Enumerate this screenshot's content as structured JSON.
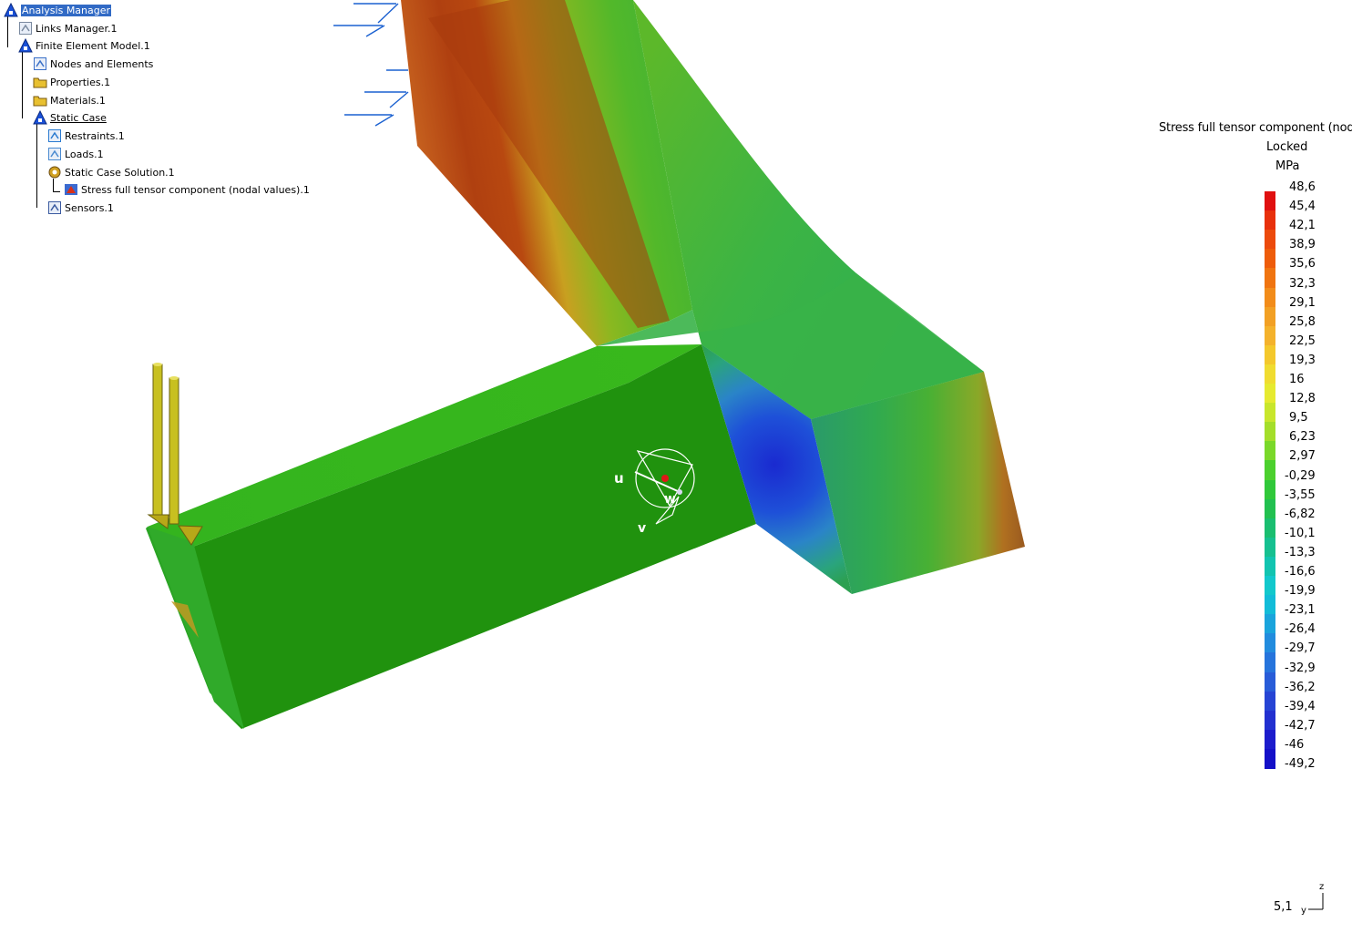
{
  "tree": [
    {
      "label": "Analysis Manager",
      "icon": "analysis-manager-icon",
      "selected": true
    },
    {
      "label": "Links Manager.1",
      "icon": "links-manager-icon"
    },
    {
      "label": "Finite Element Model.1",
      "icon": "finite-element-model-icon"
    },
    {
      "label": "Nodes and Elements",
      "icon": "nodes-elements-icon"
    },
    {
      "label": "Properties.1",
      "icon": "folder-icon"
    },
    {
      "label": "Materials.1",
      "icon": "folder-icon"
    },
    {
      "label": "Static Case",
      "icon": "static-case-icon",
      "underlined": true
    },
    {
      "label": "Restraints.1",
      "icon": "restraints-icon"
    },
    {
      "label": "Loads.1",
      "icon": "loads-icon"
    },
    {
      "label": "Static Case Solution.1",
      "icon": "solution-gear-icon"
    },
    {
      "label": "Stress full tensor component (nodal values).1",
      "icon": "stress-image-icon"
    },
    {
      "label": "Sensors.1",
      "icon": "sensors-icon"
    }
  ],
  "legend": {
    "title": "Stress full tensor component (nodal",
    "status": "Locked",
    "unit": "MPa",
    "values": [
      "48,6",
      "45,4",
      "42,1",
      "38,9",
      "35,6",
      "32,3",
      "29,1",
      "25,8",
      "22,5",
      "19,3",
      "16",
      "12,8",
      "9,5",
      "6,23",
      "2,97",
      "-0,29",
      "-3,55",
      "-6,82",
      "-10,1",
      "-13,3",
      "-16,6",
      "-19,9",
      "-23,1",
      "-26,4",
      "-29,7",
      "-32,9",
      "-36,2",
      "-39,4",
      "-42,7",
      "-46",
      "-49,2"
    ],
    "colors": [
      "#e01010",
      "#e8300c",
      "#ec4a0c",
      "#ee5c0a",
      "#f07410",
      "#f28c1a",
      "#f2a024",
      "#f4b22c",
      "#f4c82c",
      "#f0dc30",
      "#e6ea30",
      "#c8e62c",
      "#a4de2a",
      "#7ad82a",
      "#4cd02e",
      "#30c83a",
      "#22c050",
      "#1abe70",
      "#16c090",
      "#12c4b0",
      "#12c8cc",
      "#12bcd8",
      "#1aa4dc",
      "#228cde",
      "#2674dc",
      "#285cd8",
      "#2644d4",
      "#2230d0",
      "#1c1ccc",
      "#1410c8",
      "#0c08c0"
    ]
  },
  "triad": {
    "u": "u",
    "v": "v",
    "w": "w"
  },
  "axis": {
    "zoom": "5,1",
    "z": "z",
    "y": "y"
  }
}
